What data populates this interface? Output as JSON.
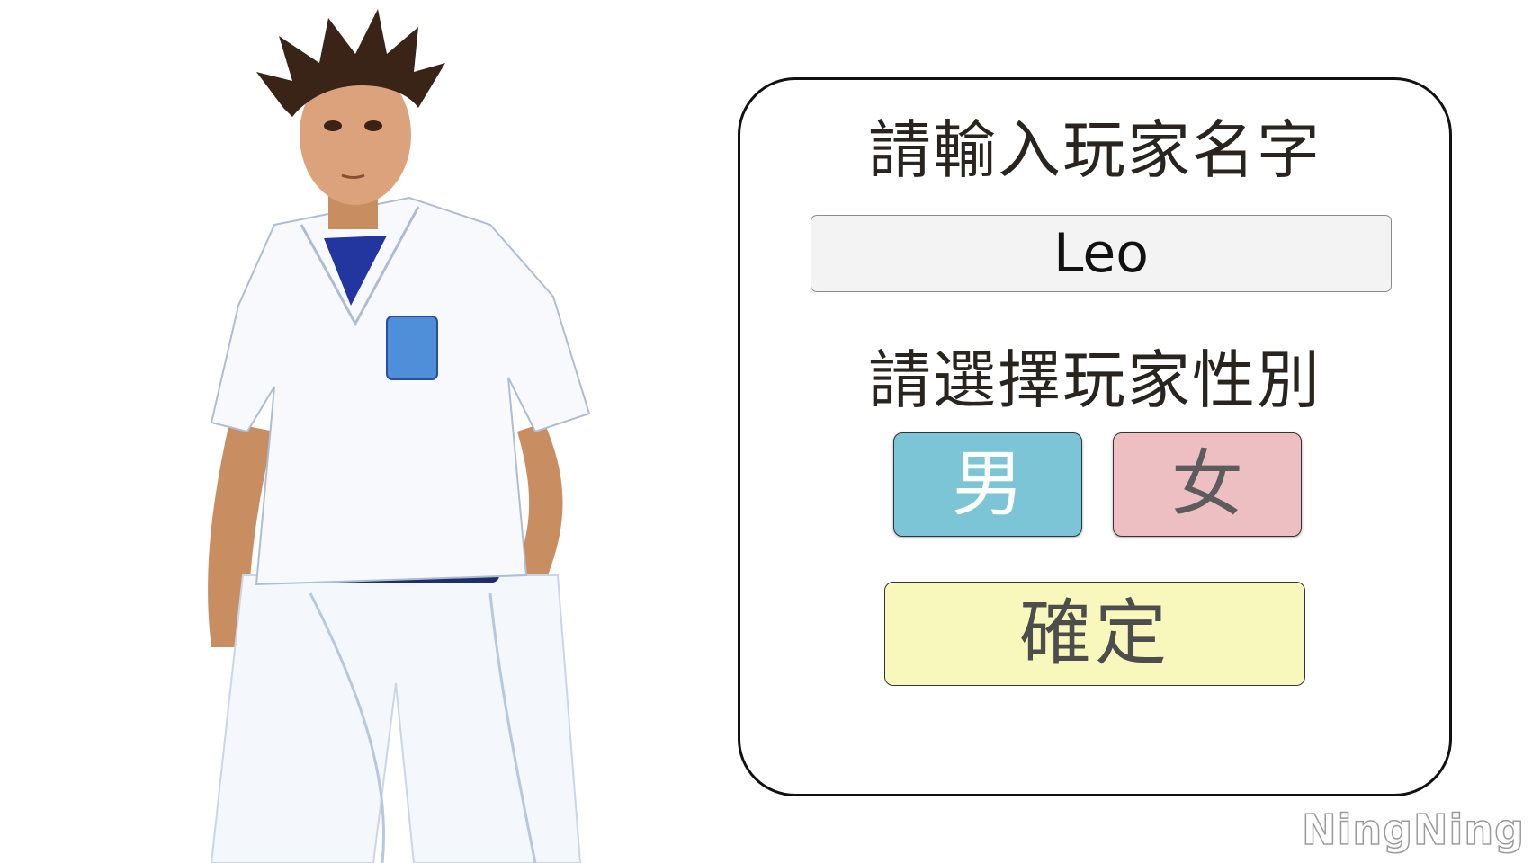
{
  "character": {
    "description_icon": "anime-boy-character-illustration"
  },
  "dialog": {
    "name_prompt": "請輸入玩家名字",
    "name_value": "Leo",
    "gender_prompt": "請選擇玩家性別",
    "male_label": "男",
    "female_label": "女",
    "confirm_label": "確定"
  },
  "watermark": {
    "text": "NingNing"
  },
  "colors": {
    "male_button": "#7cc5d6",
    "female_button": "#eebfc2",
    "confirm_button": "#f8f8bd",
    "input_background": "#f3f3f3"
  }
}
